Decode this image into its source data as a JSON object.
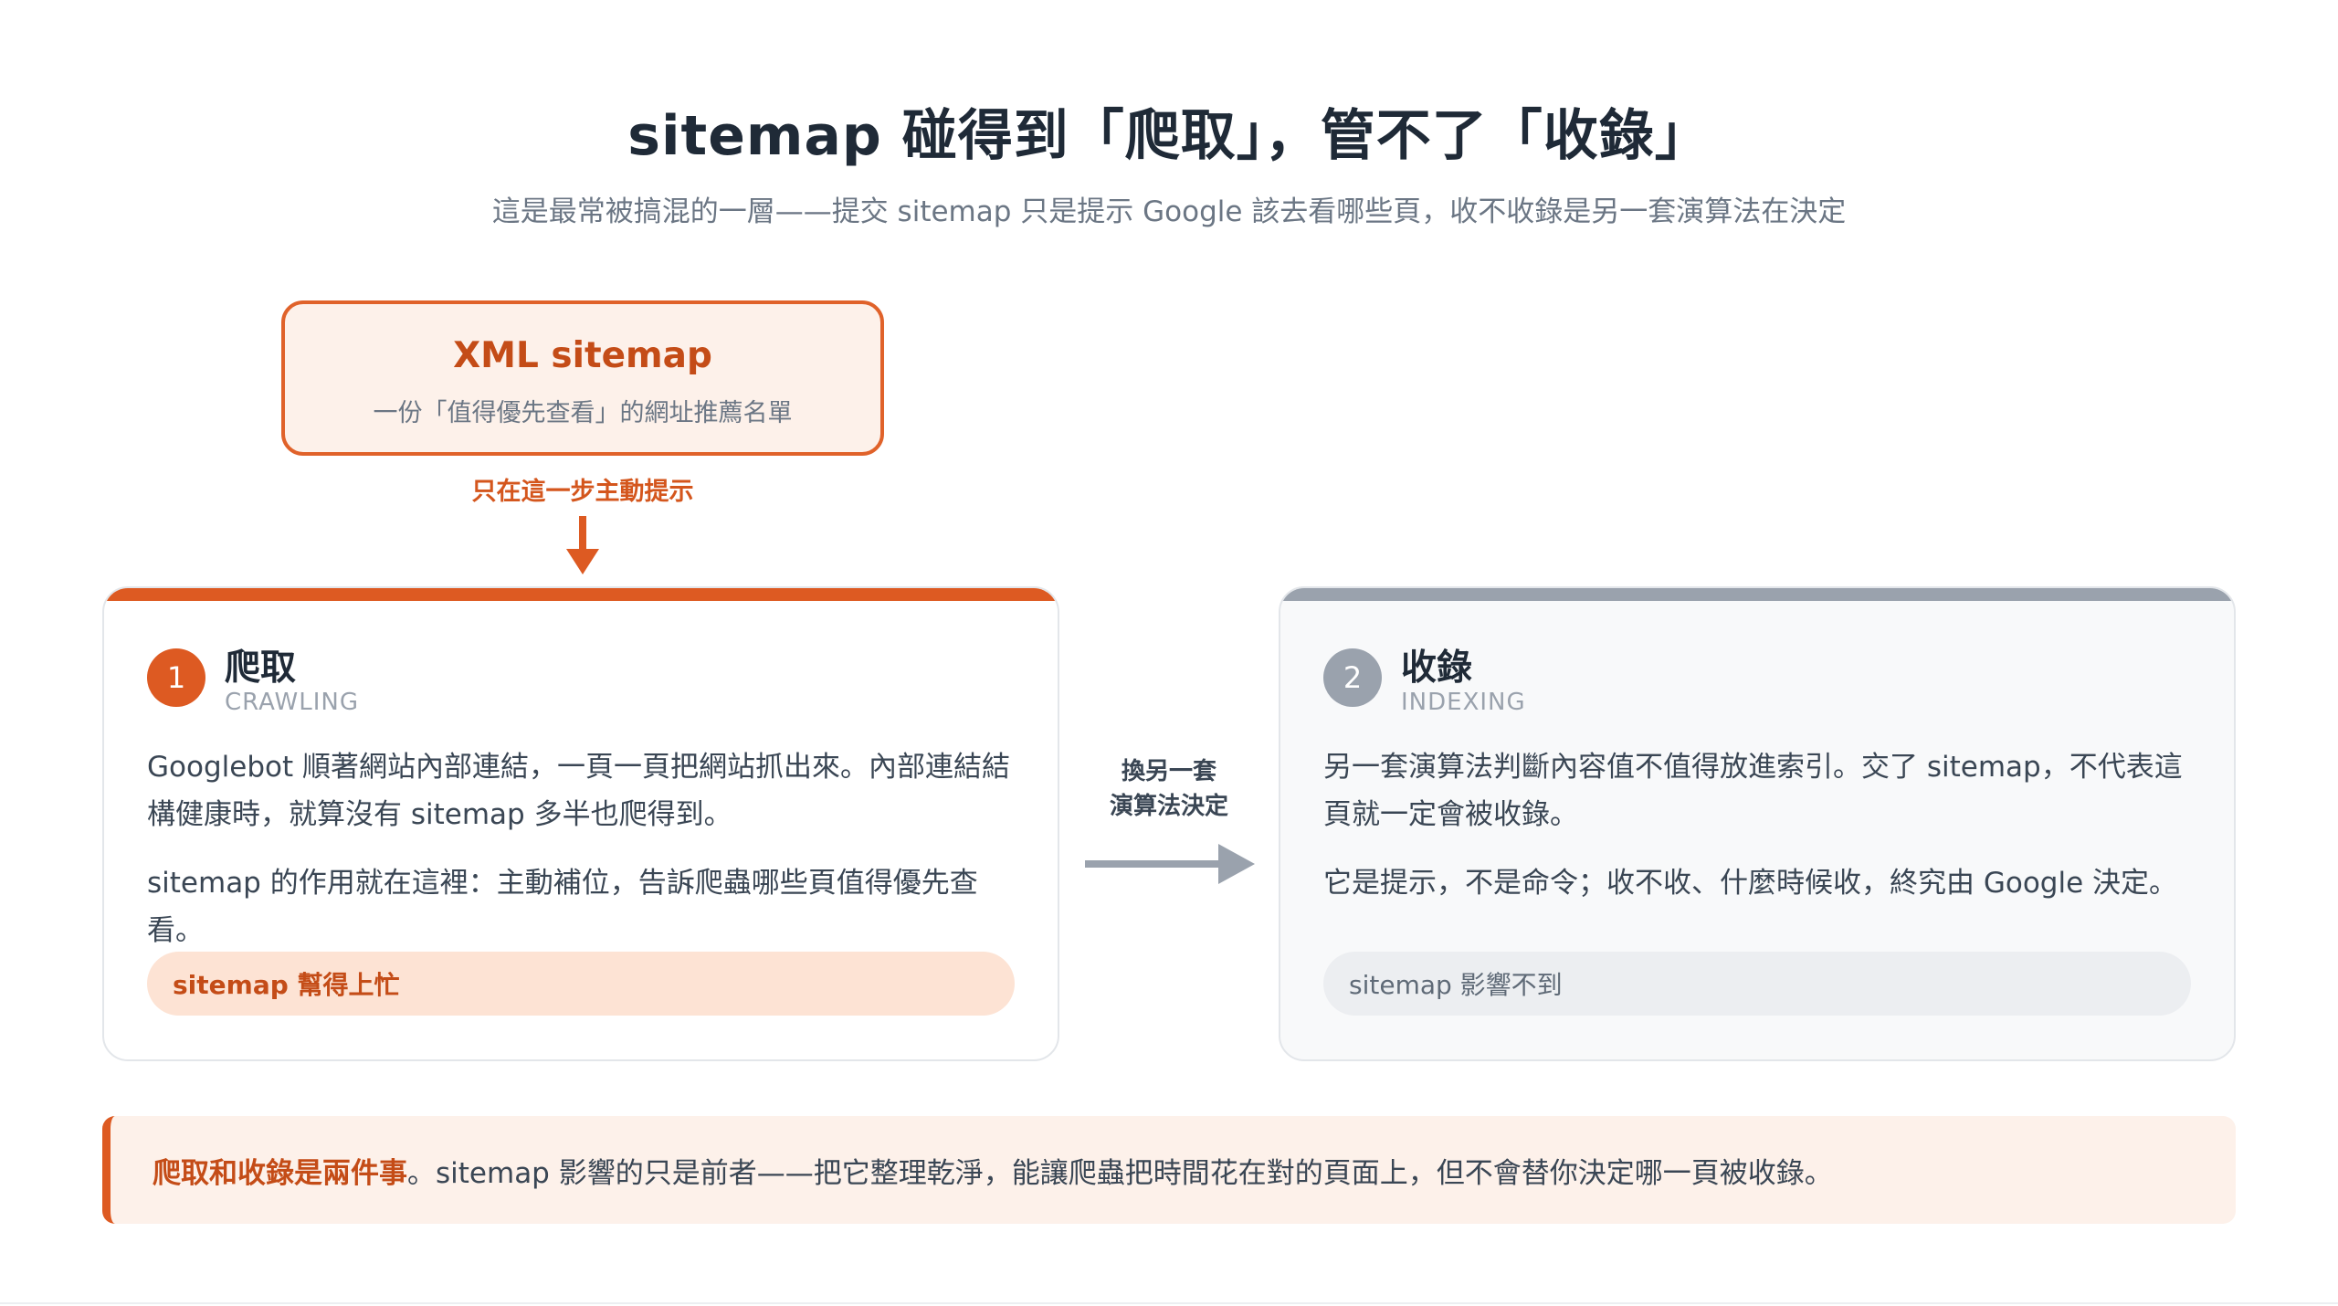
{
  "title": "sitemap 碰得到「爬取」，管不了「收錄」",
  "subtitle": "這是最常被搞混的一層——提交 sitemap 只是提示 Google 該去看哪些頁，收不收錄是另一套演算法在決定",
  "source": {
    "title": "XML sitemap",
    "description": "一份「值得優先查看」的網址推薦名單"
  },
  "source_hint": "只在這一步主動提示",
  "steps": [
    {
      "number": "1",
      "title": "爬取",
      "subtitle": "CRAWLING",
      "paragraph1": "Googlebot 順著網站內部連結，一頁一頁把網站抓出來。內部連結結構健康時，就算沒有 sitemap 多半也爬得到。",
      "paragraph2": "sitemap 的作用就在這裡：主動補位，告訴爬蟲哪些頁值得優先查看。",
      "pill": "sitemap 幫得上忙"
    },
    {
      "number": "2",
      "title": "收錄",
      "subtitle": "INDEXING",
      "paragraph1": "另一套演算法判斷內容值不值得放進索引。交了 sitemap，不代表這頁就一定會被收錄。",
      "paragraph2": "它是提示，不是命令；收不收、什麼時候收，終究由 Google 決定。",
      "pill": "sitemap 影響不到"
    }
  ],
  "connector": {
    "line1": "換另一套",
    "line2": "演算法決定"
  },
  "note": {
    "strong": "爬取和收錄是兩件事",
    "text": "。sitemap 影響的只是前者——把它整理乾淨，能讓爬蟲把時間花在對的頁面上，但不會替你決定哪一頁被收錄。"
  },
  "colors": {
    "accent": "#dd5a22",
    "accent_light": "#fdf1ea",
    "muted": "#9aa2ad",
    "text": "#3a4654"
  },
  "icons": {
    "down_arrow": "arrow-down-icon",
    "right_arrow": "arrow-right-icon"
  }
}
